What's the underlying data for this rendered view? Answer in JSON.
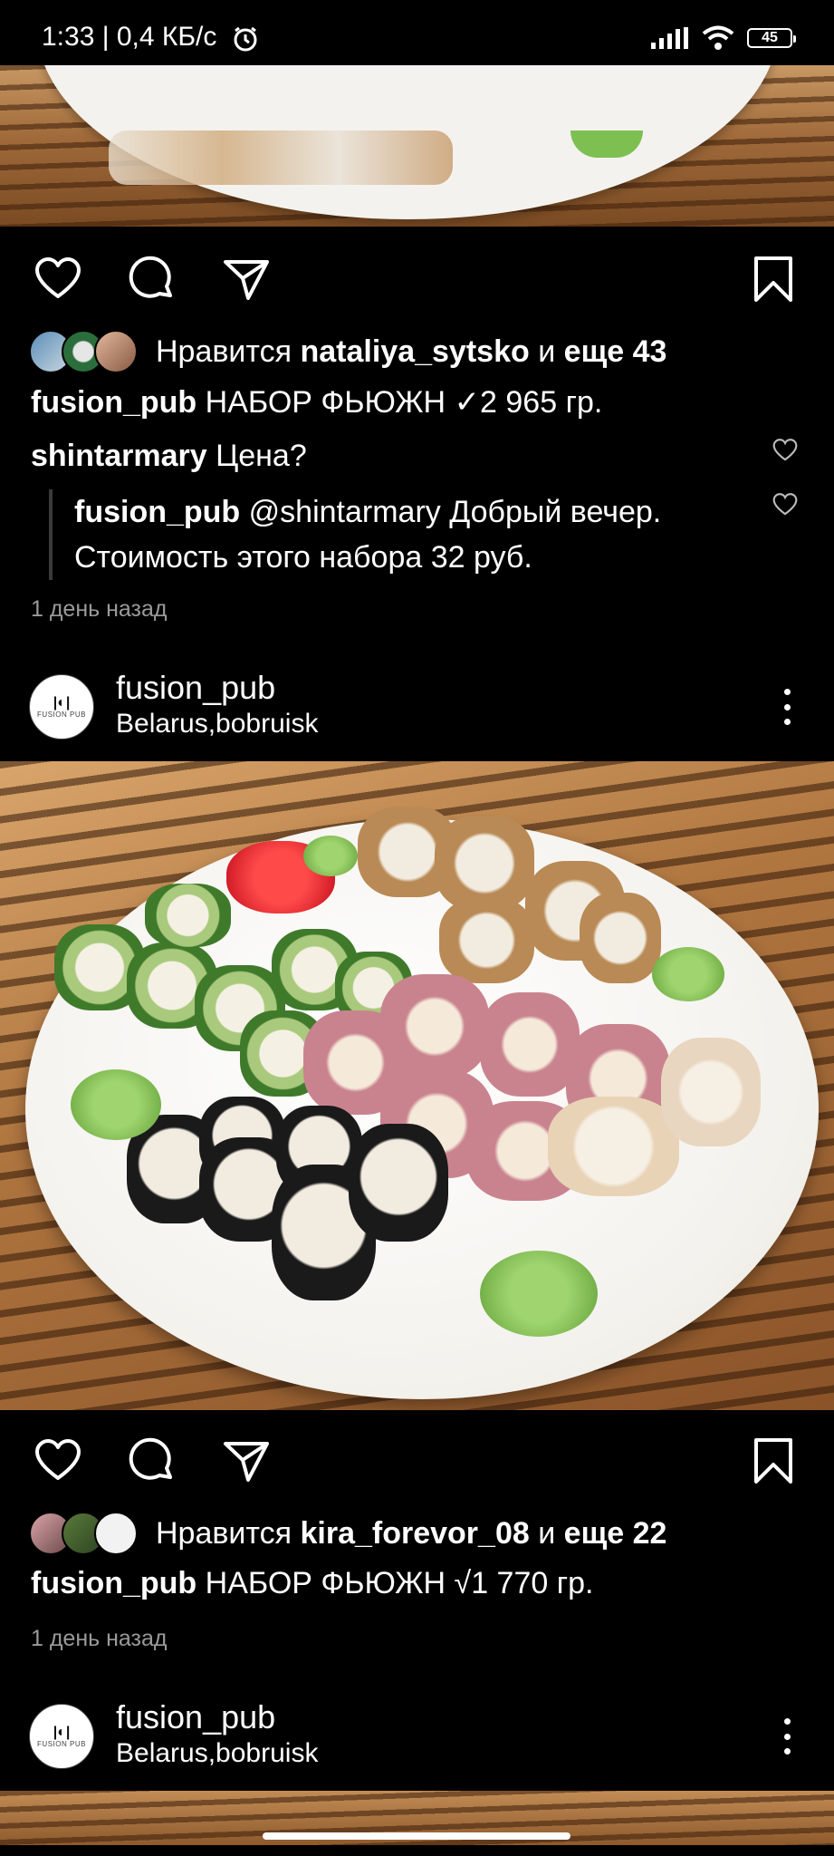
{
  "status_bar": {
    "time_speed": "1:33 | 0,4 КБ/с",
    "battery": "45"
  },
  "post1": {
    "likes_prefix": "Нравится",
    "likes_user": "nataliya_sytsko",
    "likes_and": "и",
    "likes_more": "еще 43",
    "caption_user": "fusion_pub",
    "caption_text": "НАБОР ФЬЮЖН ✓2 965 гр.",
    "comment_user": "shintarmary",
    "comment_text": "Цена?",
    "reply_user": "fusion_pub",
    "reply_text": "@shintarmary Добрый вечер. Стоимость этого набора 32 руб.",
    "time": "1 день назад"
  },
  "post2": {
    "username": "fusion_pub",
    "location": "Belarus,bobruisk",
    "likes_prefix": "Нравится",
    "likes_user": "kira_forevor_08",
    "likes_and": "и",
    "likes_more": "еще 22",
    "caption_user": "fusion_pub",
    "caption_text": "НАБОР ФЬЮЖН √1 770 гр.",
    "time": "1 день назад"
  },
  "post3": {
    "username": "fusion_pub",
    "location": "Belarus,bobruisk"
  },
  "icons": [
    "heart-icon",
    "comment-icon",
    "share-icon",
    "bookmark-icon",
    "more-icon",
    "alarm-icon",
    "signal-icon",
    "wifi-icon",
    "battery-icon"
  ],
  "colors": {
    "background": "#000000",
    "text": "#ffffff",
    "muted": "#9a9a9a"
  }
}
